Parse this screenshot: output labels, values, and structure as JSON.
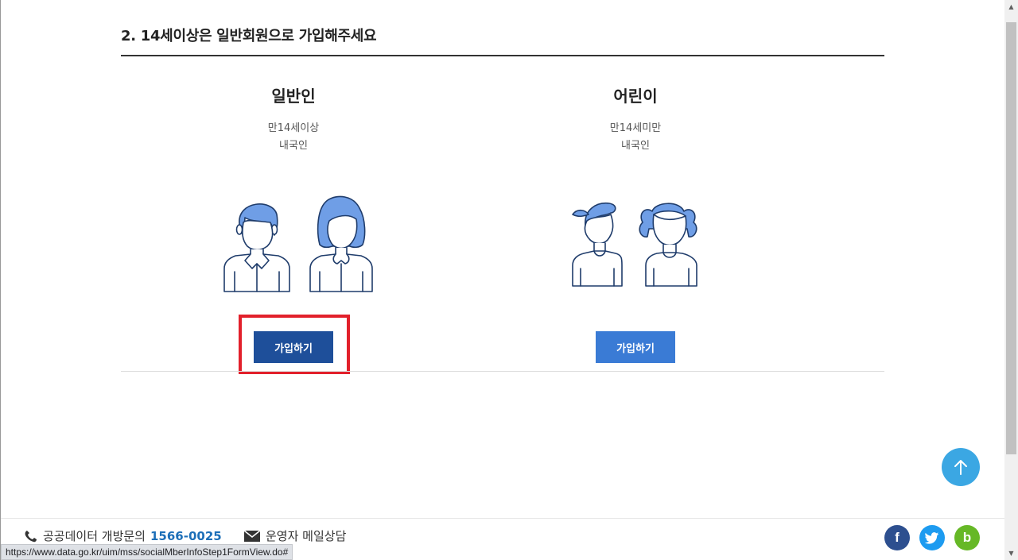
{
  "section": {
    "title": "2. 14세이상은 일반회원으로 가입해주세요"
  },
  "options": [
    {
      "title": "일반인",
      "desc_line1": "만14세이상",
      "desc_line2": "내국인",
      "button_label": "가입하기",
      "button_color": "#1e4f9a",
      "illustration": "adult-man-woman-icon"
    },
    {
      "title": "어린이",
      "desc_line1": "만14세미만",
      "desc_line2": "내국인",
      "button_label": "가입하기",
      "button_color": "#3a7bd5",
      "illustration": "boy-girl-icon"
    }
  ],
  "highlight_color": "#e2202b",
  "footer": {
    "contact_label": "공공데이터 개방문의",
    "phone": "1566-0025",
    "mail_label": "운영자 메일상담",
    "social": [
      "facebook-icon",
      "twitter-icon",
      "band-icon"
    ],
    "social_letters": {
      "facebook": "f",
      "band": "b"
    }
  },
  "status_url": "https://www.data.go.kr/uim/mss/socialMberInfoStep1FormView.do#",
  "colors": {
    "accent": "#3ba7e3",
    "title_rule": "#333333"
  }
}
